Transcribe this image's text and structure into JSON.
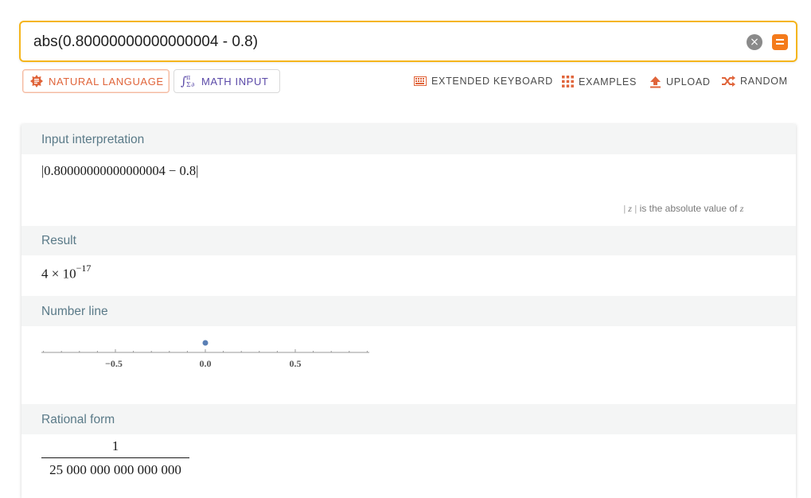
{
  "search": {
    "query": "abs(0.80000000000000004 - 0.8)",
    "clear_glyph": "×"
  },
  "modes": {
    "natural_language": "NATURAL LANGUAGE",
    "math_input": "MATH INPUT"
  },
  "toolbar": {
    "extended_keyboard": "EXTENDED KEYBOARD",
    "examples": "EXAMPLES",
    "upload": "UPLOAD",
    "random": "RANDOM"
  },
  "pods": {
    "input_interpretation": {
      "title": "Input interpretation",
      "expression": "|0.80000000000000004 − 0.8|",
      "note_symbol": "| z |",
      "note_text": "is the absolute value of",
      "note_var": "z"
    },
    "result": {
      "title": "Result",
      "mantissa": "4 × 10",
      "exponent": "−17"
    },
    "number_line": {
      "title": "Number line",
      "point_value": 4e-17,
      "ticks": [
        "−0.5",
        "0.0",
        "0.5"
      ]
    },
    "rational_form": {
      "title": "Rational form",
      "numerator": "1",
      "denominator": "25 000 000 000 000 000"
    }
  },
  "colors": {
    "accent_orange": "#f47b1c",
    "search_border": "#f5b51c",
    "math_purple": "#5b4aa8",
    "pod_header_text": "#5a7a88",
    "point_blue": "#5a7fb5"
  }
}
